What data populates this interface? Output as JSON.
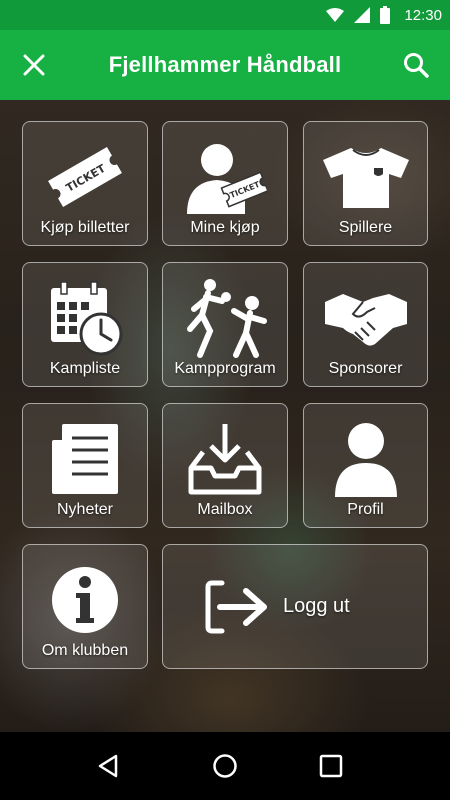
{
  "status": {
    "time": "12:30",
    "icons": [
      "wifi-icon",
      "signal-icon",
      "battery-icon"
    ]
  },
  "app_bar": {
    "title": "Fjellhammer Håndball",
    "close_icon": "close-icon",
    "search_icon": "search-icon",
    "color": "#16b043"
  },
  "tiles": [
    {
      "label": "Kjøp billetter",
      "icon": "ticket-icon",
      "ticket_text": "TICKET"
    },
    {
      "label": "Mine kjøp",
      "icon": "user-ticket-icon",
      "ticket_text": "TICKET"
    },
    {
      "label": "Spillere",
      "icon": "jersey-icon"
    },
    {
      "label": "Kampliste",
      "icon": "calendar-clock-icon"
    },
    {
      "label": "Kampprogram",
      "icon": "handball-players-icon"
    },
    {
      "label": "Sponsorer",
      "icon": "handshake-icon"
    },
    {
      "label": "Nyheter",
      "icon": "news-icon"
    },
    {
      "label": "Mailbox",
      "icon": "inbox-download-icon"
    },
    {
      "label": "Profil",
      "icon": "person-icon"
    },
    {
      "label": "Om klubben",
      "icon": "info-icon"
    },
    {
      "label": "Logg ut",
      "icon": "logout-icon"
    }
  ],
  "nav": {
    "back_icon": "back-icon",
    "home_icon": "home-icon",
    "recents_icon": "recents-icon"
  }
}
